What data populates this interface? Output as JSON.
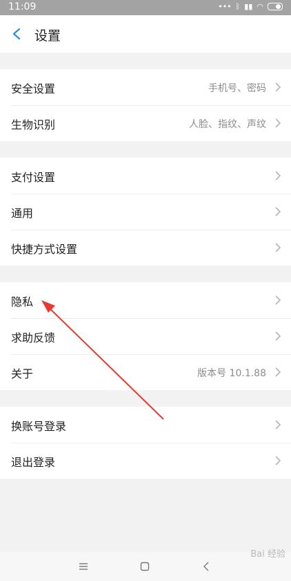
{
  "status_bar": {
    "time": "11:09",
    "icons": [
      "more-icon",
      "bluetooth-icon",
      "signal-icon",
      "wifi-icon",
      "battery-icon"
    ]
  },
  "header": {
    "title": "设置"
  },
  "sections": [
    {
      "items": [
        {
          "label": "安全设置",
          "value": "手机号、密码"
        },
        {
          "label": "生物识别",
          "value": "人脸、指纹、声纹"
        }
      ]
    },
    {
      "items": [
        {
          "label": "支付设置",
          "value": ""
        },
        {
          "label": "通用",
          "value": ""
        },
        {
          "label": "快捷方式设置",
          "value": ""
        }
      ]
    },
    {
      "items": [
        {
          "label": "隐私",
          "value": ""
        },
        {
          "label": "求助反馈",
          "value": ""
        },
        {
          "label": "关于",
          "value": "版本号 10.1.88"
        }
      ]
    },
    {
      "items": [
        {
          "label": "换账号登录",
          "value": ""
        },
        {
          "label": "退出登录",
          "value": ""
        }
      ]
    }
  ],
  "watermark": "Bai 经验",
  "colors": {
    "accent": "#2a8ee0",
    "annotation": "#e8382f",
    "status_bar": "#a3a3a3",
    "background": "#f2f2f2"
  }
}
